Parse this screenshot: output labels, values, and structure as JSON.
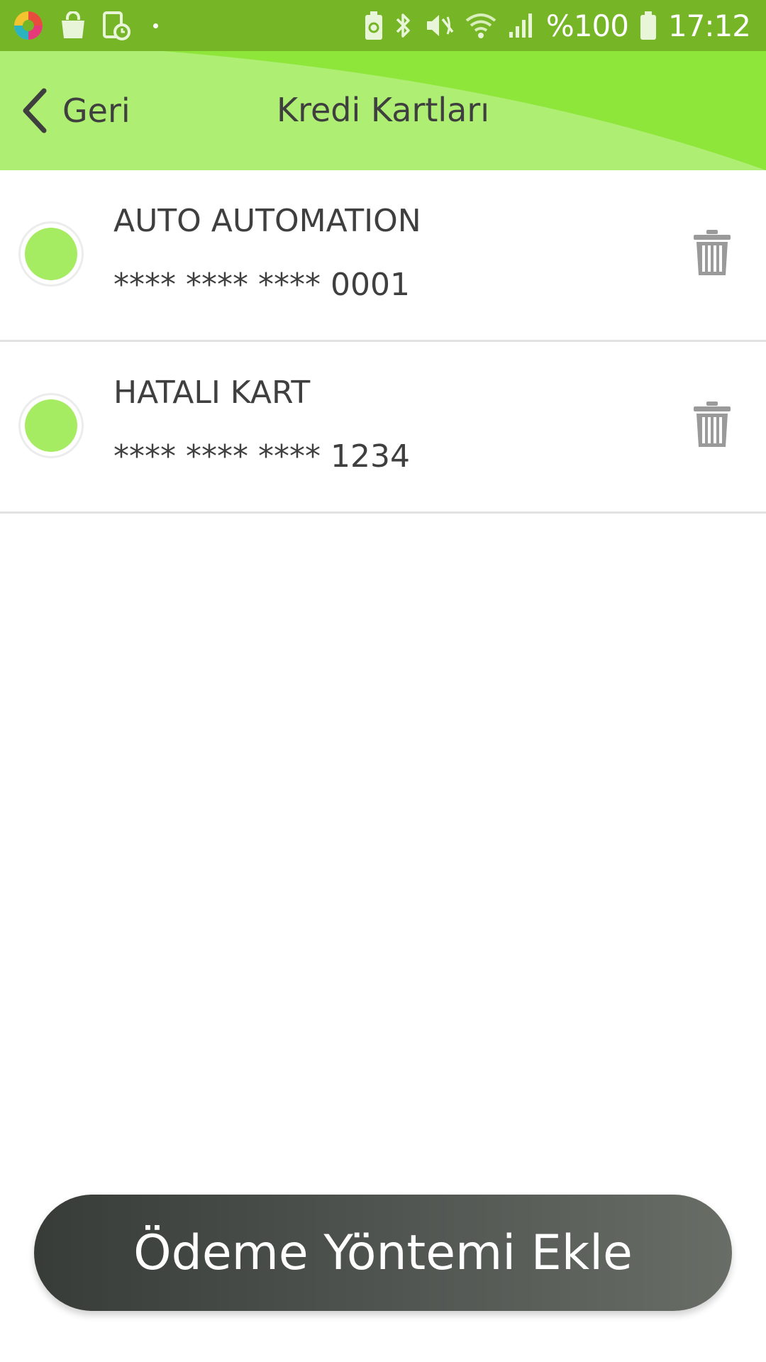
{
  "status_bar": {
    "battery_text": "%100",
    "time": "17:12",
    "icons": [
      "app-launcher-icon",
      "shopping-bag-icon",
      "schedule-icon",
      "notification-dot-icon",
      "battery-saver-icon",
      "bluetooth-icon",
      "mute-icon",
      "wifi-icon",
      "signal-icon",
      "battery-icon"
    ],
    "background_color": "#75b526"
  },
  "header": {
    "back_label": "Geri",
    "title": "Kredi Kartları",
    "background_color": "#8ee63a",
    "wave_color": "#aeee72"
  },
  "cards": [
    {
      "name": "AUTO AUTOMATION",
      "number": "**** **** **** 0001"
    },
    {
      "name": "HATALI KART",
      "number": "**** **** **** 1234"
    }
  ],
  "add_button": {
    "label": "Ödeme Yöntemi Ekle"
  },
  "colors": {
    "radio_fill": "#a6ec63",
    "text": "#3f3f3f",
    "trash_icon": "#9a9a9a",
    "button_gradient_start": "#383c38",
    "button_gradient_end": "#686d66"
  }
}
